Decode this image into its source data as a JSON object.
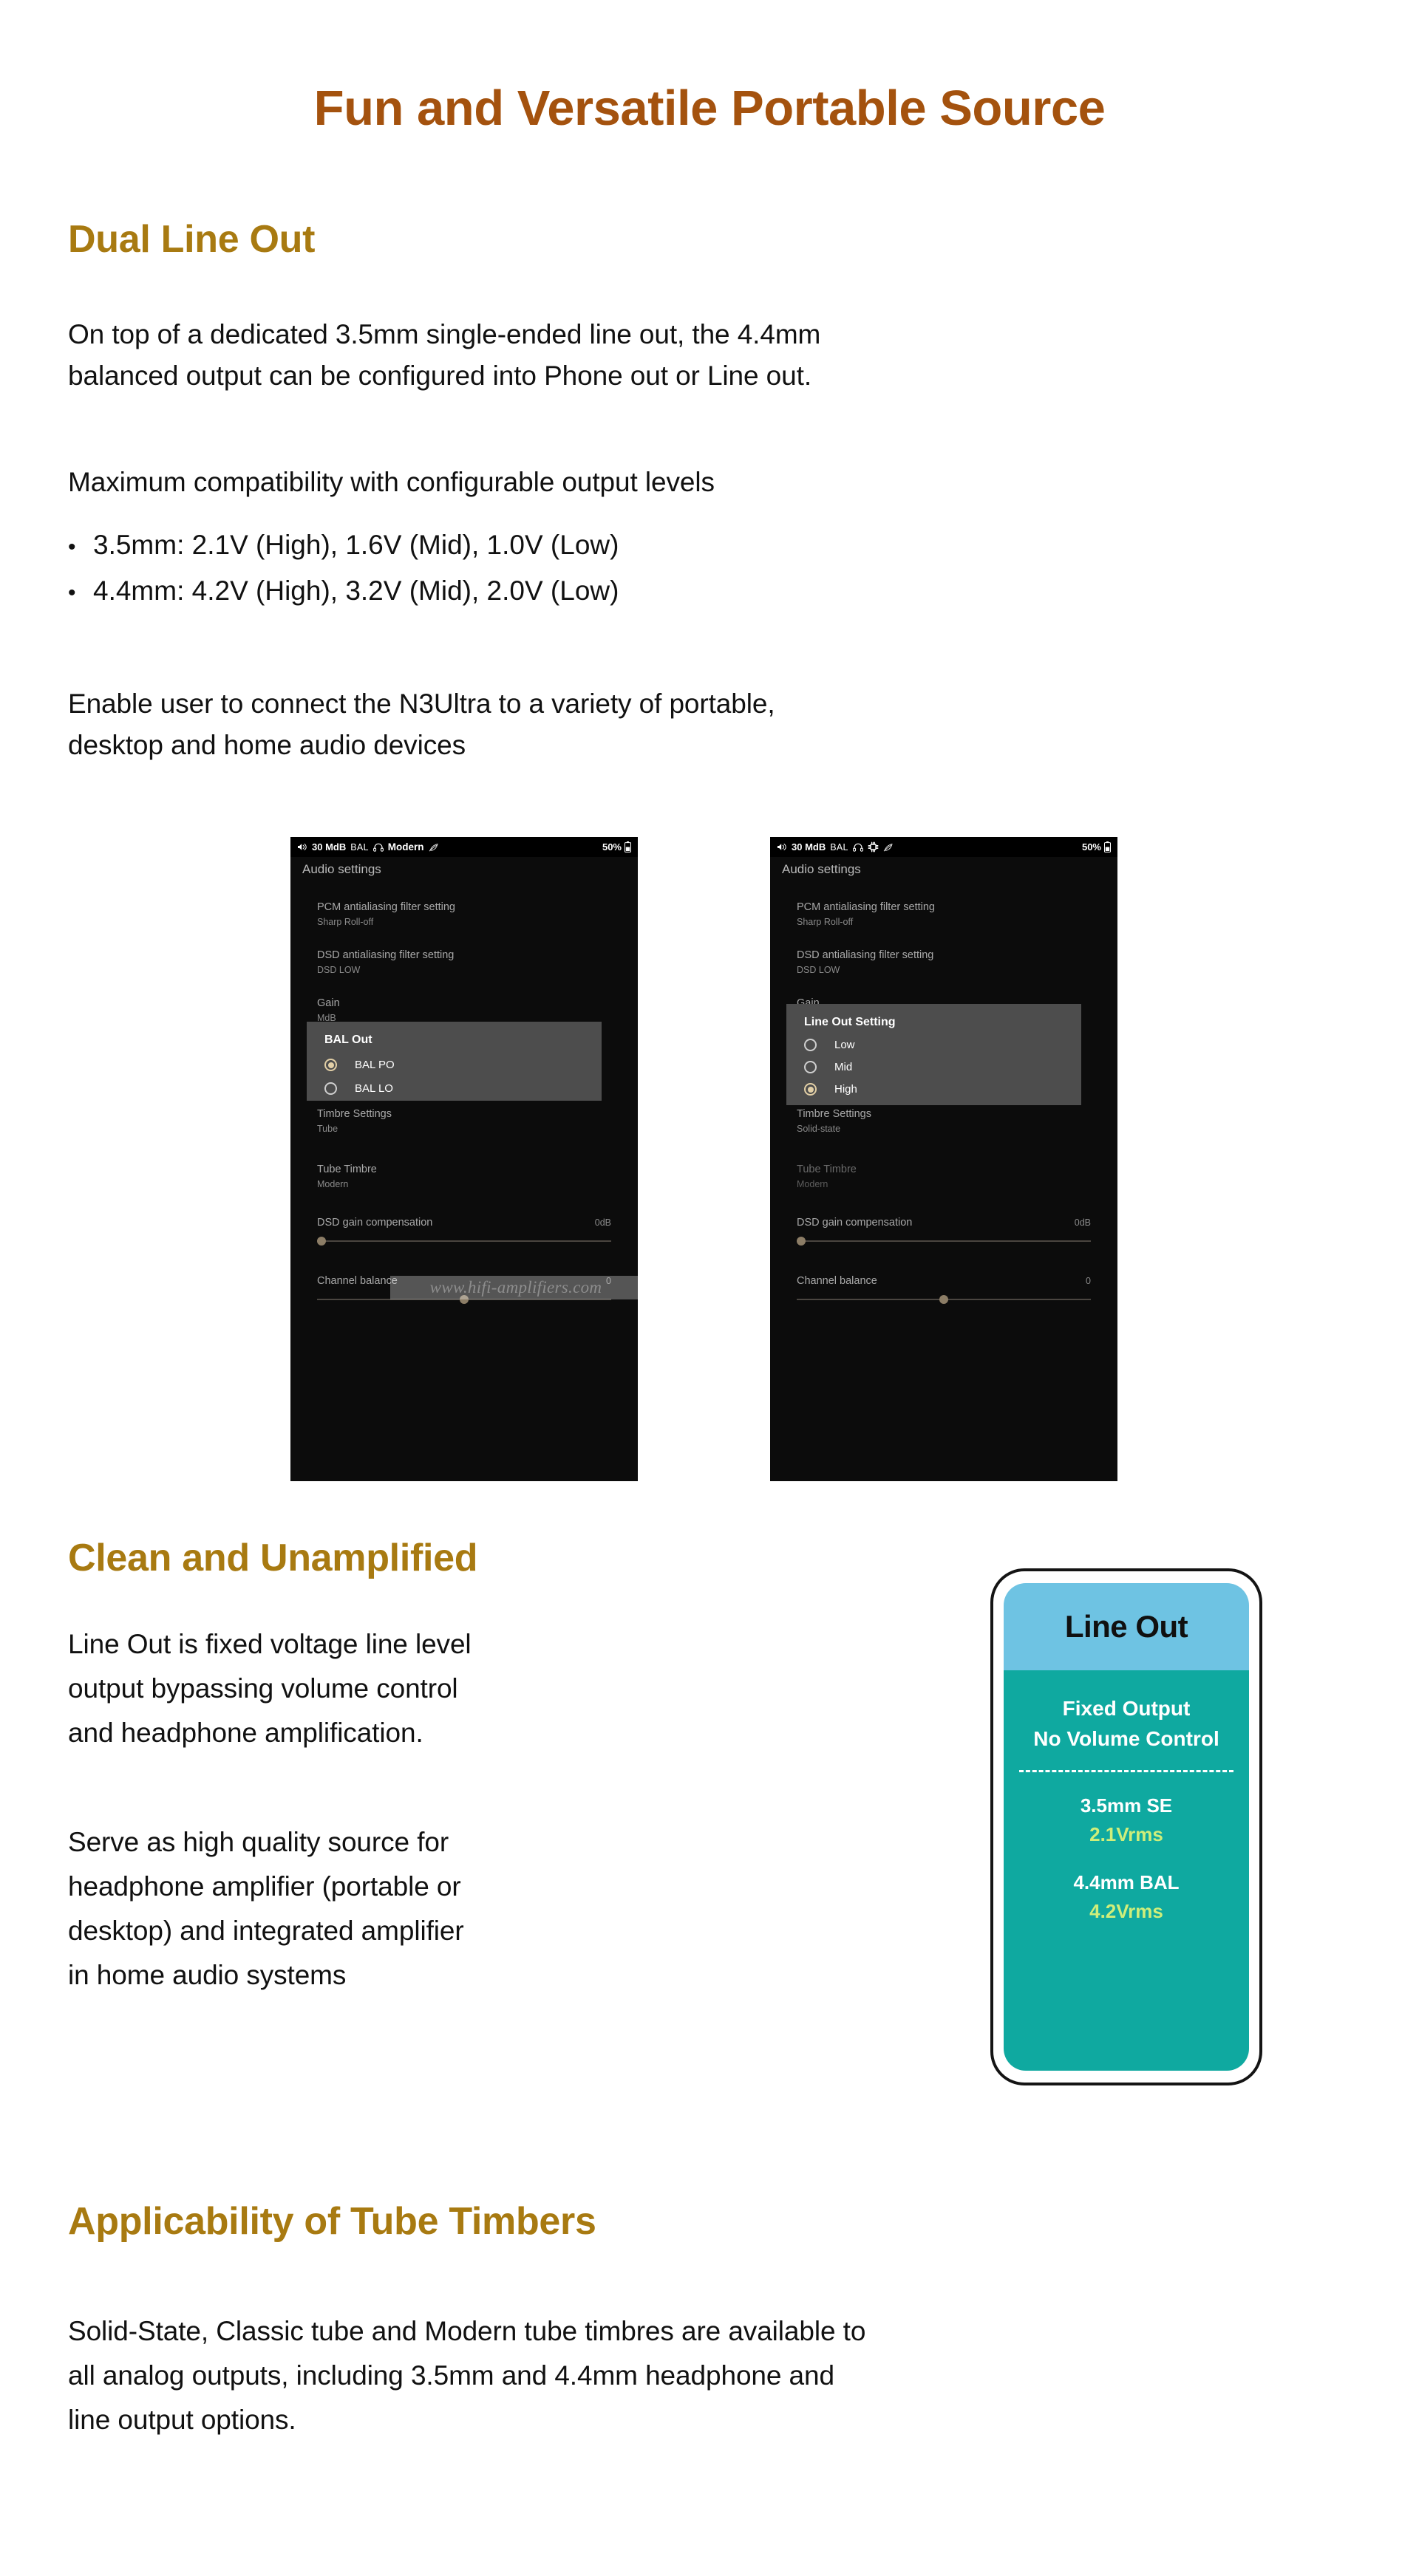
{
  "title": "Fun and Versatile Portable Source",
  "sections": {
    "dual_line_out": {
      "heading": "Dual Line Out",
      "intro_lines": [
        "On top of a dedicated 3.5mm single-ended line out, the 4.4mm",
        " balanced output can be configured into Phone out or Line out."
      ],
      "max_compat_line": "Maximum compatibility with configurable output levels",
      "bullets": [
        "3.5mm: 2.1V (High), 1.6V (Mid), 1.0V (Low)",
        "4.4mm: 4.2V (High), 3.2V (Mid), 2.0V (Low)"
      ],
      "bullet_marker": "•",
      "enable_lines": [
        "Enable user to connect the N3Ultra to a variety of portable,",
        "desktop and home audio devices"
      ]
    },
    "clean_unamplified": {
      "heading": "Clean and Unamplified",
      "para1_lines": [
        "Line Out is fixed voltage line level",
        "output bypassing volume control",
        "and headphone amplification."
      ],
      "para2_lines": [
        "Serve as high quality source for",
        "headphone amplifier (portable or",
        "desktop) and integrated amplifier",
        "in home audio systems"
      ]
    },
    "tube_timbers": {
      "heading": "Applicability of Tube Timbers",
      "para_lines": [
        "Solid-State, Classic tube and Modern tube timbres are available to",
        "all analog outputs, including 3.5mm and 4.4mm headphone and",
        "line output options."
      ]
    }
  },
  "watermark": "www.hifi-amplifiers.com",
  "phone_left": {
    "statusbar": {
      "volume": "30 MdB",
      "bal": "BAL",
      "mode": "Modern",
      "battery": "50%"
    },
    "screen_title": "Audio settings",
    "rows": {
      "pcm_label": "PCM antialiasing filter setting",
      "pcm_value": "Sharp Roll-off",
      "dsd_label": "DSD antialiasing filter setting",
      "dsd_value": "DSD LOW",
      "gain_label": "Gain",
      "gain_value": "MdB",
      "timbre_label": "Timbre Settings",
      "timbre_value": "Tube",
      "tube_timbre_label": "Tube Timbre",
      "tube_timbre_value": "Modern",
      "dsd_gain_label": "DSD gain compensation",
      "dsd_gain_value": "0dB",
      "channel_balance_label": "Channel balance",
      "channel_balance_value": "0"
    },
    "dialog": {
      "title": "BAL Out",
      "options": [
        {
          "label": "BAL PO",
          "selected": true
        },
        {
          "label": "BAL LO",
          "selected": false
        }
      ]
    }
  },
  "phone_right": {
    "statusbar": {
      "volume": "30 MdB",
      "bal": "BAL",
      "battery": "50%"
    },
    "screen_title": "Audio settings",
    "rows": {
      "pcm_label": "PCM antialiasing filter setting",
      "pcm_value": "Sharp Roll-off",
      "dsd_label": "DSD antialiasing filter setting",
      "dsd_value": "DSD LOW",
      "gain_label": "Gain",
      "timbre_label": "Timbre Settings",
      "timbre_value": "Solid-state",
      "tube_timbre_label": "Tube Timbre",
      "tube_timbre_value": "Modern",
      "dsd_gain_label": "DSD gain compensation",
      "dsd_gain_value": "0dB",
      "channel_balance_label": "Channel balance",
      "channel_balance_value": "0"
    },
    "dialog": {
      "title": "Line Out Setting",
      "options": [
        {
          "label": "Low",
          "selected": false
        },
        {
          "label": "Mid",
          "selected": false
        },
        {
          "label": "High",
          "selected": true
        }
      ]
    }
  },
  "lineout_card": {
    "header": "Line Out",
    "line1": "Fixed Output",
    "line2": "No Volume Control",
    "spec1_label": "3.5mm SE",
    "spec1_value": "2.1Vrms",
    "spec2_label": "4.4mm BAL",
    "spec2_value": "4.2Vrms"
  },
  "colors": {
    "title": "#A4520E",
    "section_heading": "#A87A11",
    "card_header_bg": "#6EC3E3",
    "card_body_bg": "#0FA9A0",
    "card_value_text": "#CFEE7A",
    "radio_accent": "#E2CFA6"
  }
}
